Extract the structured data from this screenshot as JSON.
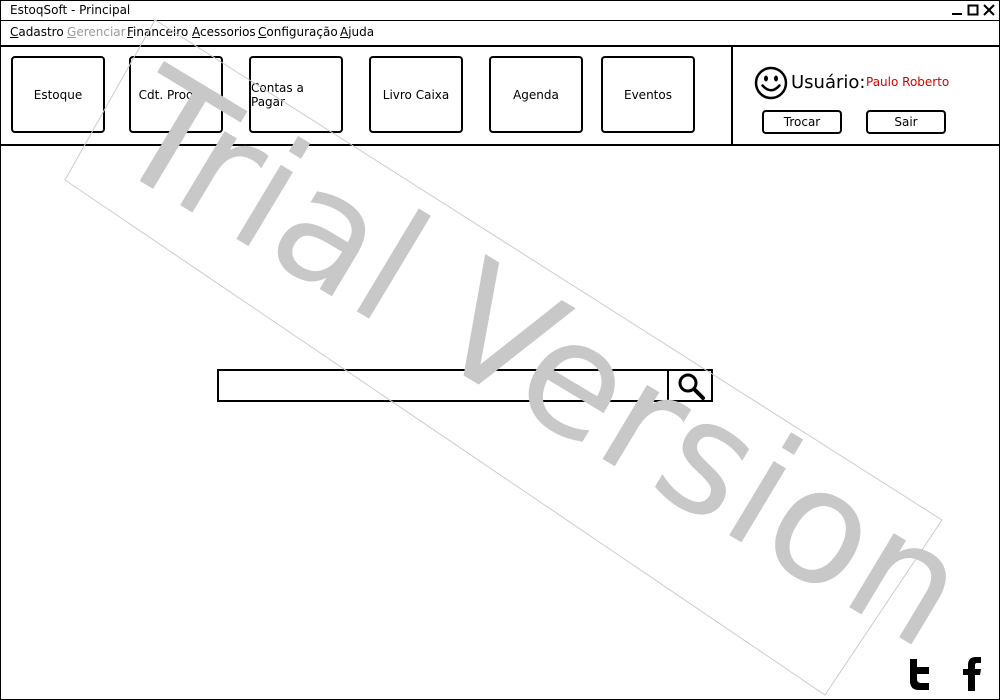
{
  "window": {
    "title": "EstoqSoft - Principal"
  },
  "menu": {
    "items": [
      {
        "first": "C",
        "rest": "adastro",
        "disabled": false
      },
      {
        "first": "G",
        "rest": "erenciar",
        "disabled": true
      },
      {
        "first": "F",
        "rest": "inanceiro",
        "disabled": false
      },
      {
        "first": "A",
        "rest": "cessorios",
        "disabled": false
      },
      {
        "first": "C",
        "rest": "onfiguração",
        "disabled": false
      },
      {
        "first": "A",
        "rest": "juda",
        "disabled": false
      }
    ]
  },
  "toolbar": {
    "buttons": [
      "Estoque",
      "Cdt. Produto",
      "Contas a Pagar",
      "Livro Caixa",
      "Agenda",
      "Eventos"
    ]
  },
  "user": {
    "label": "Usuário:",
    "name": "Paulo Roberto",
    "switch_label": "Trocar",
    "exit_label": "Sair",
    "name_color": "#d40000"
  },
  "watermark": {
    "text": "Trial Version"
  },
  "search": {
    "value": "",
    "placeholder": ""
  },
  "icons": {
    "search": "search-icon",
    "twitter": "twitter-icon",
    "facebook": "facebook-icon",
    "smiley": "smiley-icon"
  }
}
